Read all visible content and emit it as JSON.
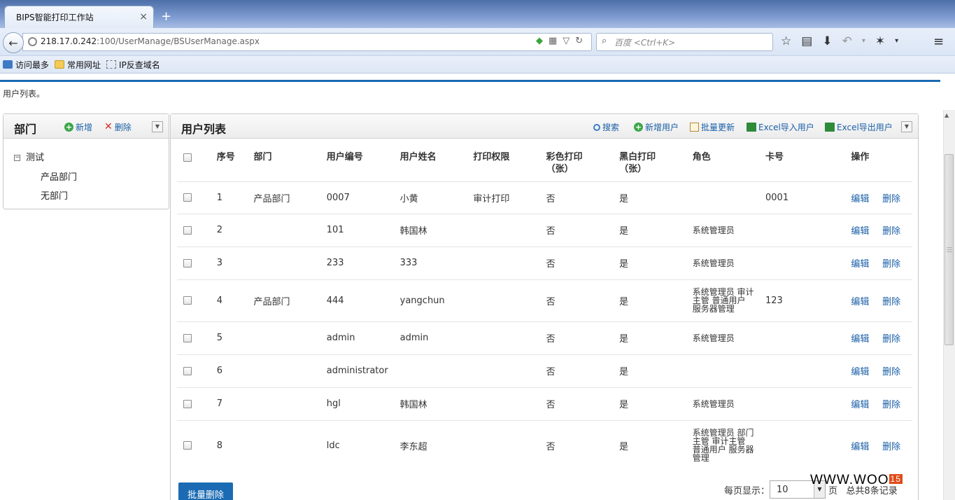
{
  "browser": {
    "tab_title": "BIPS智能打印工作站",
    "tab_close": "×",
    "new_tab": "+",
    "url_host": "218.17.0.242",
    "url_path": ":100/UserManage/BSUserManage.aspx",
    "search_placeholder": "百度 <Ctrl+K>",
    "bookmarks": [
      "访问最多",
      "常用网址",
      "IP反查域名"
    ]
  },
  "page": {
    "breadcrumb": "用户列表。"
  },
  "dept_panel": {
    "title": "部门",
    "add_label": "新增",
    "delete_label": "删除",
    "root": "测试",
    "children": [
      "产品部门",
      "无部门"
    ]
  },
  "user_panel": {
    "title": "用户列表",
    "toolbar": {
      "search": "搜索",
      "add_user": "新增用户",
      "batch_update": "批量更新",
      "excel_import": "Excel导入用户",
      "excel_export": "Excel导出用户"
    },
    "columns": {
      "no": "序号",
      "dept": "部门",
      "code": "用户编号",
      "name": "用户姓名",
      "perm": "打印权限",
      "color_1": "彩色打印",
      "color_2": "（张）",
      "bw_1": "黑白打印",
      "bw_2": "（张）",
      "role": "角色",
      "card": "卡号",
      "op": "操作"
    },
    "rows": [
      {
        "no": "1",
        "dept": "产品部门",
        "code": "0007",
        "name": "小黄",
        "perm": "审计打印",
        "color": "否",
        "bw": "是",
        "role1": "",
        "role2": "",
        "role3": "",
        "card": "0001",
        "edit": "编辑",
        "del": "删除"
      },
      {
        "no": "2",
        "dept": "",
        "code": "101",
        "name": "韩国林",
        "perm": "",
        "color": "否",
        "bw": "是",
        "role1": "系统管理员",
        "role2": "",
        "role3": "",
        "card": "",
        "edit": "编辑",
        "del": "删除"
      },
      {
        "no": "3",
        "dept": "",
        "code": "233",
        "name": "333",
        "perm": "",
        "color": "否",
        "bw": "是",
        "role1": "系统管理员",
        "role2": "",
        "role3": "",
        "card": "",
        "edit": "编辑",
        "del": "删除"
      },
      {
        "no": "4",
        "dept": "产品部门",
        "code": "444",
        "name": "yangchun",
        "perm": "",
        "color": "否",
        "bw": "是",
        "role1": "系统管理员 审计",
        "role2": "主管 普通用户",
        "role3": "服务器管理",
        "card": "123",
        "edit": "编辑",
        "del": "删除"
      },
      {
        "no": "5",
        "dept": "",
        "code": "admin",
        "name": "admin",
        "perm": "",
        "color": "否",
        "bw": "是",
        "role1": "系统管理员",
        "role2": "",
        "role3": "",
        "card": "",
        "edit": "编辑",
        "del": "删除"
      },
      {
        "no": "6",
        "dept": "",
        "code": "administrator",
        "name": "",
        "perm": "",
        "color": "否",
        "bw": "是",
        "role1": "",
        "role2": "",
        "role3": "",
        "card": "",
        "edit": "编辑",
        "del": "删除"
      },
      {
        "no": "7",
        "dept": "",
        "code": "hgl",
        "name": "韩国林",
        "perm": "",
        "color": "否",
        "bw": "是",
        "role1": "系统管理员",
        "role2": "",
        "role3": "",
        "card": "",
        "edit": "编辑",
        "del": "删除"
      },
      {
        "no": "8",
        "dept": "",
        "code": "ldc",
        "name": "李东超",
        "perm": "",
        "color": "否",
        "bw": "是",
        "role1": "系统管理员 部门",
        "role2": "主管 审计主管",
        "role3": "普通用户 服务器",
        "role4": "管理",
        "card": "",
        "edit": "编辑",
        "del": "删除"
      }
    ],
    "batch_delete": "批量删除",
    "pager": {
      "per_page_label": "每页显示：",
      "per_page_value": "10",
      "page_unit": "页",
      "total": "总共8条记录"
    }
  },
  "watermark": {
    "text": "WWW.WOO",
    "badge": "15"
  },
  "colors": {
    "accent": "#1a6bb3",
    "link": "#1a5fa8",
    "add_green": "#3ea64a",
    "delete_red": "#d0302b"
  }
}
